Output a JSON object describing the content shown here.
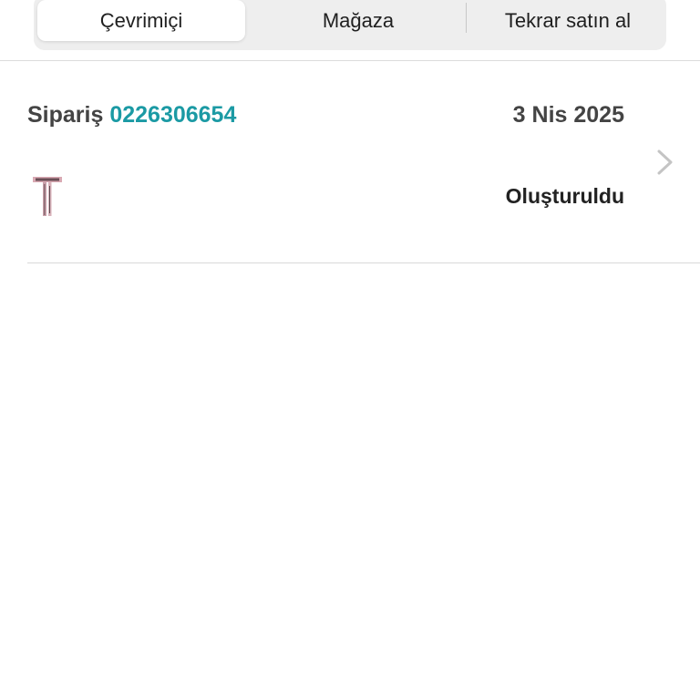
{
  "tabs": [
    {
      "label": "Çevrimiçi",
      "active": true
    },
    {
      "label": "Mağaza",
      "active": false
    },
    {
      "label": "Tekrar satın al",
      "active": false
    }
  ],
  "order": {
    "prefix": "Sipariş",
    "number": "0226306654",
    "date": "3 Nis 2025",
    "status": "Oluşturuldu",
    "thumbnail_icon": "mascara-product-thumbnail",
    "chevron_icon": "chevron-right-icon"
  },
  "colors": {
    "accent": "#1b9aa4",
    "text_dark": "#222222",
    "segment_bg": "#eeeeee"
  }
}
